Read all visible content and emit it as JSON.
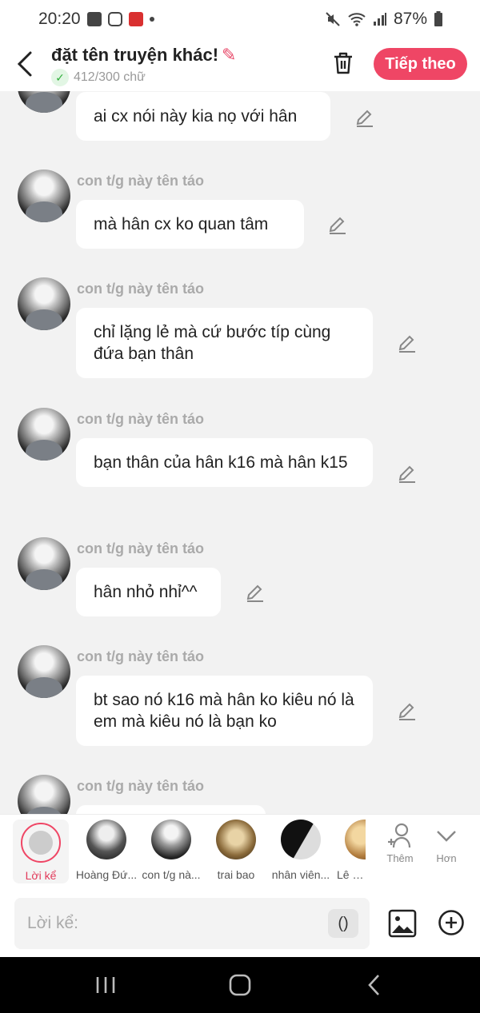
{
  "status": {
    "time": "20:20",
    "battery": "87%"
  },
  "header": {
    "title": "đặt tên truyện khác!",
    "char_count": "412/300 chữ",
    "next_label": "Tiếp theo"
  },
  "messages": [
    {
      "name": "",
      "text": "ai cx nói này kia nọ với hân"
    },
    {
      "name": "con t/g này tên táo",
      "text": "mà hân cx ko quan tâm"
    },
    {
      "name": "con t/g này tên táo",
      "text": "chỉ lặng lẻ mà cứ bước típ cùng đứa bạn thân"
    },
    {
      "name": "con t/g này tên táo",
      "text": "bạn thân của hân k16 mà hân k15"
    },
    {
      "name": "con t/g này tên táo",
      "text": "hân nhỏ nhỉ^^"
    },
    {
      "name": "con t/g này tên táo",
      "text": "bt sao nó k16 mà hân ko kiêu nó là em mà kiêu nó là bạn ko"
    },
    {
      "name": "con t/g này tên táo",
      "text": ""
    }
  ],
  "characters": [
    {
      "label": "Lời kể"
    },
    {
      "label": "Hoàng Đứ..."
    },
    {
      "label": "con t/g nà..."
    },
    {
      "label": "trai bao"
    },
    {
      "label": "nhân viên..."
    },
    {
      "label": "Lê Qu"
    }
  ],
  "actions": {
    "add_label": "Thêm",
    "more_label": "Hơn"
  },
  "composer": {
    "placeholder": "Lời kể:",
    "paren": "()"
  }
}
